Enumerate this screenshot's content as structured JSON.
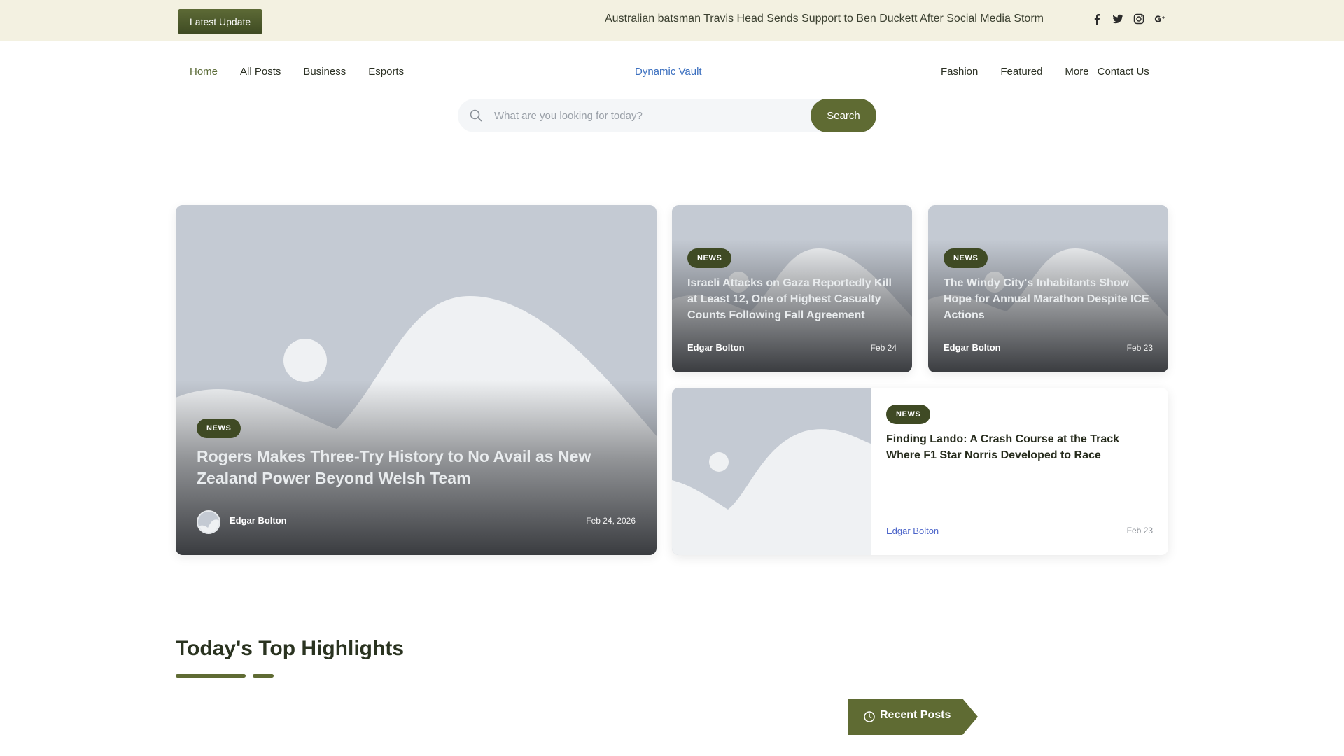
{
  "topbar": {
    "latest_label": "Latest Update",
    "ticker": "Australian batsman Travis Head Sends Support to Ben Duckett After Social Media Storm",
    "social": [
      "facebook-icon",
      "twitter-icon",
      "instagram-icon",
      "google-plus-icon"
    ]
  },
  "nav": {
    "left": [
      "Home",
      "All Posts",
      "Business",
      "Esports"
    ],
    "brand": "Dynamic Vault",
    "right": [
      "Fashion",
      "Featured",
      "More",
      "Contact Us"
    ]
  },
  "search": {
    "placeholder": "What are you looking for today?",
    "button": "Search"
  },
  "featured": {
    "main": {
      "badge": "NEWS",
      "title": "Rogers Makes Three-Try History to No Avail as New Zealand Power Beyond Welsh Team",
      "author": "Edgar Bolton",
      "date": "Feb 24, 2026"
    },
    "side": [
      {
        "badge": "NEWS",
        "title": "Israeli Attacks on Gaza Reportedly Kill at Least 12, One of Highest Casualty Counts Following Fall Agreement",
        "author": "Edgar Bolton",
        "date": "Feb 24"
      },
      {
        "badge": "NEWS",
        "title": "The Windy City's Inhabitants Show Hope for Annual Marathon Despite ICE Actions",
        "author": "Edgar Bolton",
        "date": "Feb 23"
      }
    ],
    "wide": {
      "badge": "NEWS",
      "title": "Finding Lando: A Crash Course at the Track Where F1 Star Norris Developed to Race",
      "author": "Edgar Bolton",
      "date": "Feb 23"
    }
  },
  "highlights": {
    "title": "Today's Top Highlights"
  },
  "sidebar": {
    "recent_label": "Recent Posts"
  },
  "colors": {
    "accent": "#5f6b33",
    "badge": "#3f4a24",
    "topbar_bg": "#f3f1e1",
    "brand": "#3b6fbf",
    "placeholder_bg": "#c4cad3"
  }
}
